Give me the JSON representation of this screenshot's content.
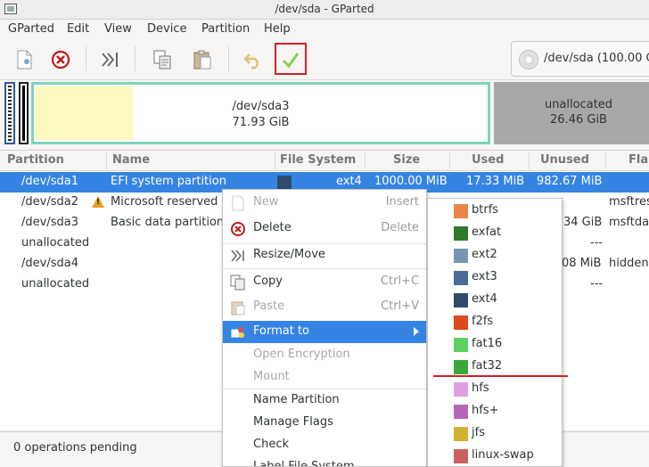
{
  "window": {
    "title": "/dev/sda - GParted"
  },
  "menubar": {
    "items": [
      "GParted",
      "Edit",
      "View",
      "Device",
      "Partition",
      "Help"
    ]
  },
  "device_selector": {
    "label": "/dev/sda (100.00 G"
  },
  "disk_map": {
    "sda3": {
      "name": "/dev/sda3",
      "size": "71.93 GiB"
    },
    "unallocated": {
      "name": "unallocated",
      "size": "26.46 GiB"
    }
  },
  "table": {
    "columns": [
      "Partition",
      "Name",
      "File System",
      "Size",
      "Used",
      "Unused",
      "Fla"
    ],
    "rows": [
      {
        "partition": "/dev/sda1",
        "name": "EFI system partition",
        "filesystem": "ext4",
        "size": "1000.00 MiB",
        "used": "17.33 MiB",
        "unused": "982.67 MiB",
        "flags": ""
      },
      {
        "partition": "/dev/sda2",
        "name": "Microsoft reserved",
        "filesystem": "",
        "size": "",
        "used": "",
        "unused": "",
        "flags": "msftres"
      },
      {
        "partition": "/dev/sda3",
        "name": "Basic data partition",
        "filesystem": "",
        "size": "",
        "used": "",
        "unused": "34 GiB",
        "flags": "msftdata"
      },
      {
        "partition": "unallocated",
        "name": "",
        "filesystem": "",
        "size": "",
        "used": "",
        "unused": "---",
        "flags": ""
      },
      {
        "partition": "/dev/sda4",
        "name": "",
        "filesystem": "",
        "size": "",
        "used": "",
        "unused": "08 MiB",
        "flags": "hidden"
      },
      {
        "partition": "unallocated",
        "name": "",
        "filesystem": "",
        "size": "",
        "used": "",
        "unused": "---",
        "flags": ""
      }
    ]
  },
  "status": {
    "text": "0 operations pending"
  },
  "context_menu": {
    "items": [
      {
        "label": "New",
        "accel": "Insert",
        "disabled": true
      },
      {
        "label": "Delete",
        "accel": "Delete",
        "disabled": false
      },
      {
        "label": "Resize/Move",
        "accel": "",
        "disabled": false
      },
      {
        "label": "Copy",
        "accel": "Ctrl+C",
        "disabled": false
      },
      {
        "label": "Paste",
        "accel": "Ctrl+V",
        "disabled": true
      },
      {
        "label": "Format to",
        "accel": "",
        "disabled": false,
        "highlighted": true
      },
      {
        "label": "Open Encryption",
        "accel": "",
        "disabled": true
      },
      {
        "label": "Mount",
        "accel": "",
        "disabled": true
      },
      {
        "label": "Name Partition",
        "accel": "",
        "disabled": false
      },
      {
        "label": "Manage Flags",
        "accel": "",
        "disabled": false
      },
      {
        "label": "Check",
        "accel": "",
        "disabled": false
      },
      {
        "label": "Label File System",
        "accel": "",
        "disabled": false
      }
    ]
  },
  "format_submenu": {
    "items": [
      {
        "label": "btrfs",
        "color": "#e8844c"
      },
      {
        "label": "exfat",
        "color": "#2d7a2d"
      },
      {
        "label": "ext2",
        "color": "#7896b4"
      },
      {
        "label": "ext3",
        "color": "#4a6c94"
      },
      {
        "label": "ext4",
        "color": "#2f4a6a"
      },
      {
        "label": "f2fs",
        "color": "#dc4a20"
      },
      {
        "label": "fat16",
        "color": "#5fcf5f"
      },
      {
        "label": "fat32",
        "color": "#38a838"
      },
      {
        "label": "hfs",
        "color": "#dfa0df"
      },
      {
        "label": "hfs+",
        "color": "#b466b4"
      },
      {
        "label": "jfs",
        "color": "#d4b030"
      },
      {
        "label": "linux-swap",
        "color": "#c86060"
      }
    ]
  },
  "colors": {
    "accent": "#3584e4",
    "highlight_red": "#d0202a",
    "sda3_border": "#7ed4b8",
    "used_fill": "#fdf9bf",
    "unallocated": "#a8a8a8"
  }
}
